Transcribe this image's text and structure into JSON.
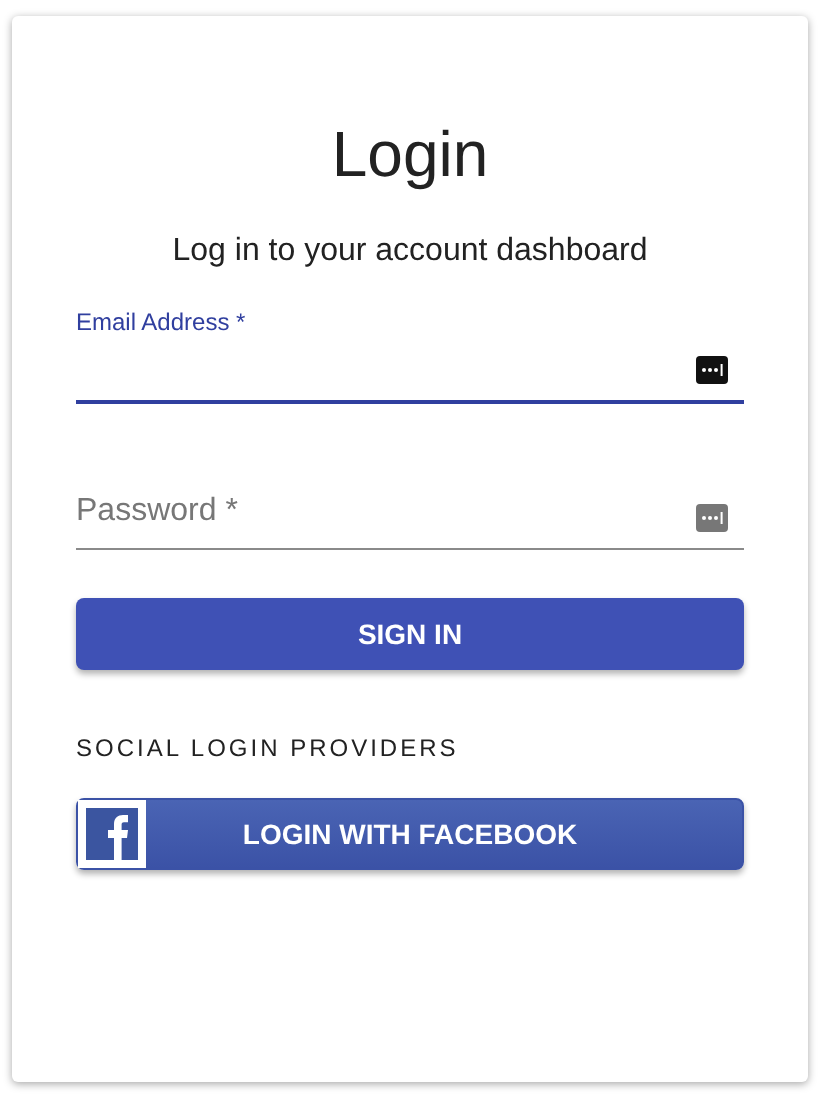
{
  "title": "Login",
  "subtitle": "Log in to your account dashboard",
  "fields": [
    {
      "label": "Email Address *",
      "focused": true
    },
    {
      "label": "Password *",
      "focused": false
    }
  ],
  "submit": "SIGN IN",
  "social_heading": "SOCIAL LOGIN PROVIDERS",
  "social_buttons": [
    {
      "label": "LOGIN WITH FACEBOOK"
    }
  ]
}
